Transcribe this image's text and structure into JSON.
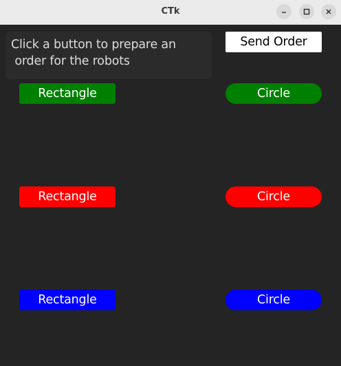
{
  "window": {
    "title": "CTk"
  },
  "info": {
    "line1": "Click a button to prepare an",
    "line2": " order for the robots"
  },
  "send_order": {
    "label": "Send Order"
  },
  "rows": [
    {
      "color_name": "green",
      "color": "#008000",
      "rectangle_label": "Rectangle",
      "circle_label": "Circle"
    },
    {
      "color_name": "red",
      "color": "#ff0000",
      "rectangle_label": "Rectangle",
      "circle_label": "Circle"
    },
    {
      "color_name": "blue",
      "color": "#0000ff",
      "rectangle_label": "Rectangle",
      "circle_label": "Circle"
    }
  ],
  "theme": {
    "background": "#242424",
    "info_box_background": "#2b2b2b",
    "send_button_background": "#ffffff"
  },
  "icons": {
    "minimize": "minimize-icon",
    "maximize": "maximize-icon",
    "close": "close-icon"
  }
}
